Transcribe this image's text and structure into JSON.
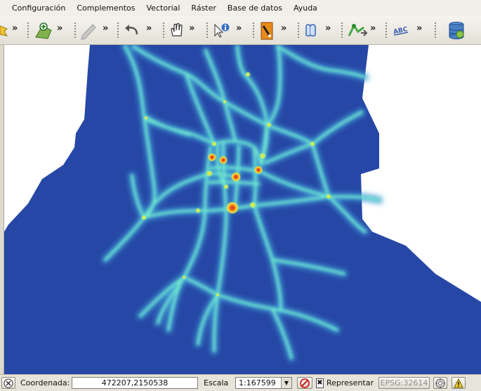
{
  "menubar": {
    "items": [
      "Configuración",
      "Complementos",
      "Vectorial",
      "Ráster",
      "Base de datos",
      "Ayuda"
    ]
  },
  "toolbar": {
    "chevron": "»",
    "tools": [
      {
        "name": "new-layer-icon"
      },
      {
        "name": "add-vector-icon"
      },
      {
        "name": "edit-pencil-icon"
      },
      {
        "name": "undo-icon"
      },
      {
        "name": "pan-hand-icon"
      },
      {
        "name": "identify-icon"
      },
      {
        "name": "measure-icon"
      },
      {
        "name": "bookmark-icon"
      },
      {
        "name": "route-icon"
      },
      {
        "name": "label-abc-icon"
      },
      {
        "name": "database-icon"
      }
    ]
  },
  "map": {
    "background": "#2647a5",
    "colors": {
      "low": "#3b8ec9",
      "mid": "#57e6c8",
      "high": "#f3e33c",
      "peak": "#e2231a"
    }
  },
  "statusbar": {
    "coordinate_label": "Coordenada:",
    "coordinate_value": "472207,2150538",
    "scale_label": "Escala",
    "scale_value": "1:167599",
    "render_label": "Representar",
    "crs": "EPSG:32614"
  }
}
